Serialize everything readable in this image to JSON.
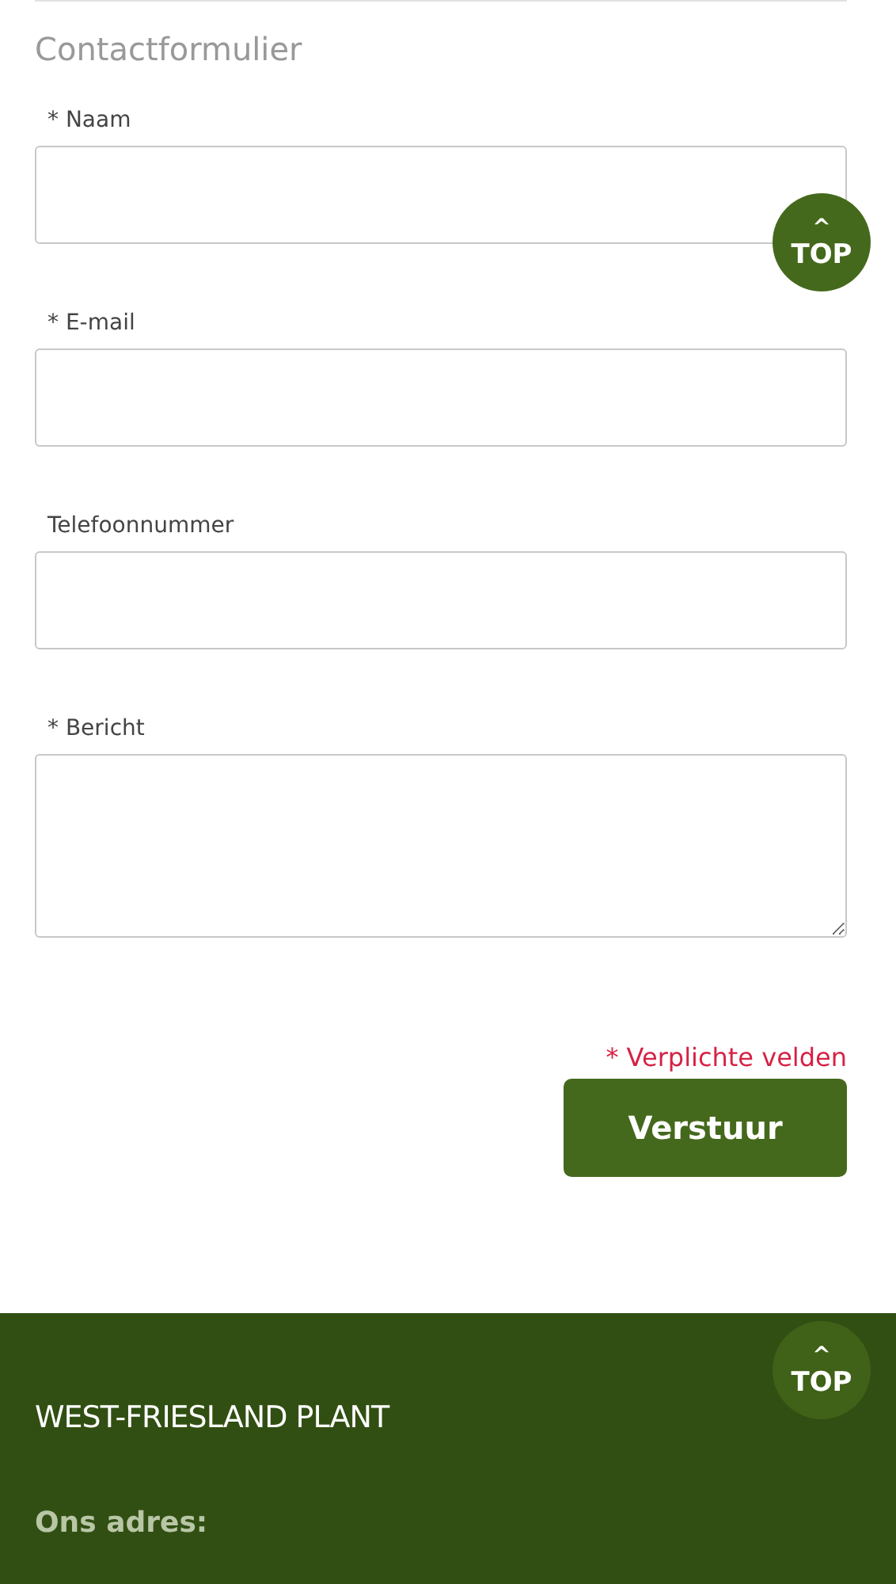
{
  "form": {
    "title": "Contactformulier",
    "fields": [
      {
        "kind": "input",
        "label": "* Naam"
      },
      {
        "kind": "input",
        "label": "* E-mail"
      },
      {
        "kind": "input",
        "label": "Telefoonnummer"
      },
      {
        "kind": "textarea",
        "label": "* Bericht"
      }
    ],
    "required_note": "* Verplichte velden",
    "submit": "Verstuur"
  },
  "top_buttons": [
    {
      "caret": "^",
      "label": "TOP"
    },
    {
      "caret": "^",
      "label": "TOP"
    }
  ],
  "footer": {
    "title": "WEST-FRIESLAND PLANT",
    "heading": "Ons adres:"
  }
}
